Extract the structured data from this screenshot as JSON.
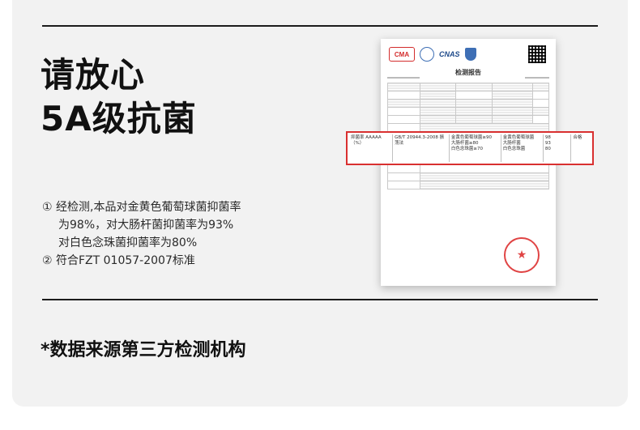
{
  "headline": {
    "line1": "请放心",
    "line2": "5A级抗菌"
  },
  "bullets": {
    "item1_line1": "① 经检测,本品对金黄色葡萄球菌抑菌率",
    "item1_line2": "为98%，对大肠杆菌抑菌率为93%",
    "item1_line3": "对白色念珠菌抑菌率为80%",
    "item2": "② 符合FZT 01057-2007标准"
  },
  "report": {
    "title": "检测报告",
    "logo_cma": "CMA",
    "logo_cnas": "CNAS",
    "highlight": {
      "item": "抑菌率 AAAAA（%）",
      "method": "GB/T 20944.3-2008 振荡法",
      "requirement": [
        "金黄色葡萄球菌≥90",
        "大肠杆菌≥80",
        "白色念珠菌≥70"
      ],
      "result_names": [
        "金黄色葡萄球菌",
        "大肠杆菌",
        "白色念珠菌"
      ],
      "result_values": [
        "98",
        "93",
        "80"
      ],
      "verdict": "合格"
    }
  },
  "footnote": "*数据来源第三方检测机构"
}
